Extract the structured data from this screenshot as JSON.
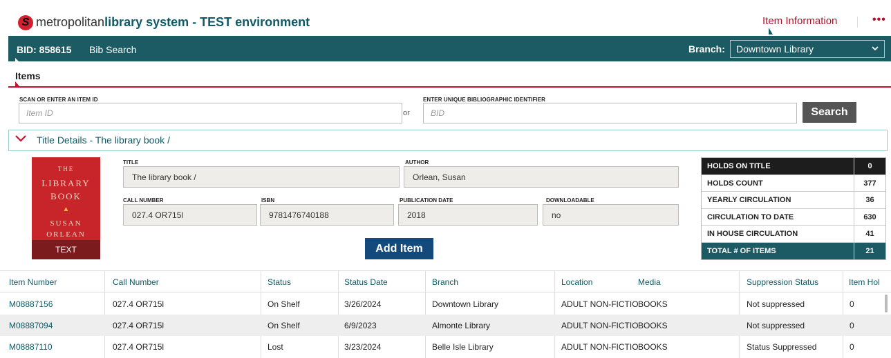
{
  "header": {
    "logo_letter": "S",
    "brand_part1": "metropolitan",
    "brand_part2": "library system - TEST environment",
    "item_information": "Item Information",
    "more": "•••"
  },
  "navbar": {
    "bid": "BID: 858615",
    "bib_search": "Bib Search",
    "branch_label": "Branch:",
    "branch_value": "Downtown Library"
  },
  "items": {
    "title": "Items",
    "scan_label": "SCAN OR ENTER AN ITEM ID",
    "item_placeholder": "Item ID",
    "or": "or",
    "bib_label": "ENTER UNIQUE BIBLIOGRAPHIC IDENTIFIER",
    "bid_placeholder": "BID",
    "search_button": "Search"
  },
  "title_details": {
    "heading": "Title Details - The library book /",
    "cover": {
      "line1": "THE",
      "line2": "LIBRARY",
      "line3": "BOOK",
      "line4": "SUSAN",
      "line5": "ORLEAN",
      "overlay": "TEXT"
    },
    "title_label": "TITLE",
    "title_value": "The library book /",
    "author_label": "AUTHOR",
    "author_value": "Orlean, Susan",
    "call_number_label": "CALL NUMBER",
    "call_number_value": "027.4 OR715l",
    "isbn_label": "ISBN",
    "isbn_value": "9781476740188",
    "pubdate_label": "PUBLICATION DATE",
    "pubdate_value": "2018",
    "downloadable_label": "DOWNLOADABLE",
    "downloadable_value": "no",
    "add_item": "Add Item"
  },
  "stats": [
    {
      "label": "HOLDS ON TITLE",
      "value": "0"
    },
    {
      "label": "HOLDS COUNT",
      "value": "377"
    },
    {
      "label": "YEARLY CIRCULATION",
      "value": "36"
    },
    {
      "label": "CIRCULATION TO DATE",
      "value": "630"
    },
    {
      "label": "IN HOUSE CIRCULATION",
      "value": "41"
    },
    {
      "label": "TOTAL # OF ITEMS",
      "value": "21"
    }
  ],
  "table": {
    "columns": [
      "Item Number",
      "Call Number",
      "Status",
      "Status Date",
      "Branch",
      "Location",
      "Media",
      "Suppression Status",
      "Item Hol"
    ],
    "rows": [
      [
        "M08887156",
        "027.4 OR715l",
        "On Shelf",
        "3/26/2024",
        "Downtown Library",
        "ADULT NON-FICTIO",
        "BOOKS",
        "Not suppressed",
        "0"
      ],
      [
        "M08887094",
        "027.4 OR715l",
        "On Shelf",
        "6/9/2023",
        "Almonte Library",
        "ADULT NON-FICTIO",
        "BOOKS",
        "Not suppressed",
        "0"
      ],
      [
        "M08887110",
        "027.4 OR715l",
        "Lost",
        "3/23/2024",
        "Belle Isle Library",
        "ADULT NON-FICTIO",
        "BOOKS",
        "Status Suppressed",
        "0"
      ]
    ]
  },
  "colors": {
    "teal": "#1c5b63",
    "red": "#c8102e",
    "navy": "#14497c"
  }
}
